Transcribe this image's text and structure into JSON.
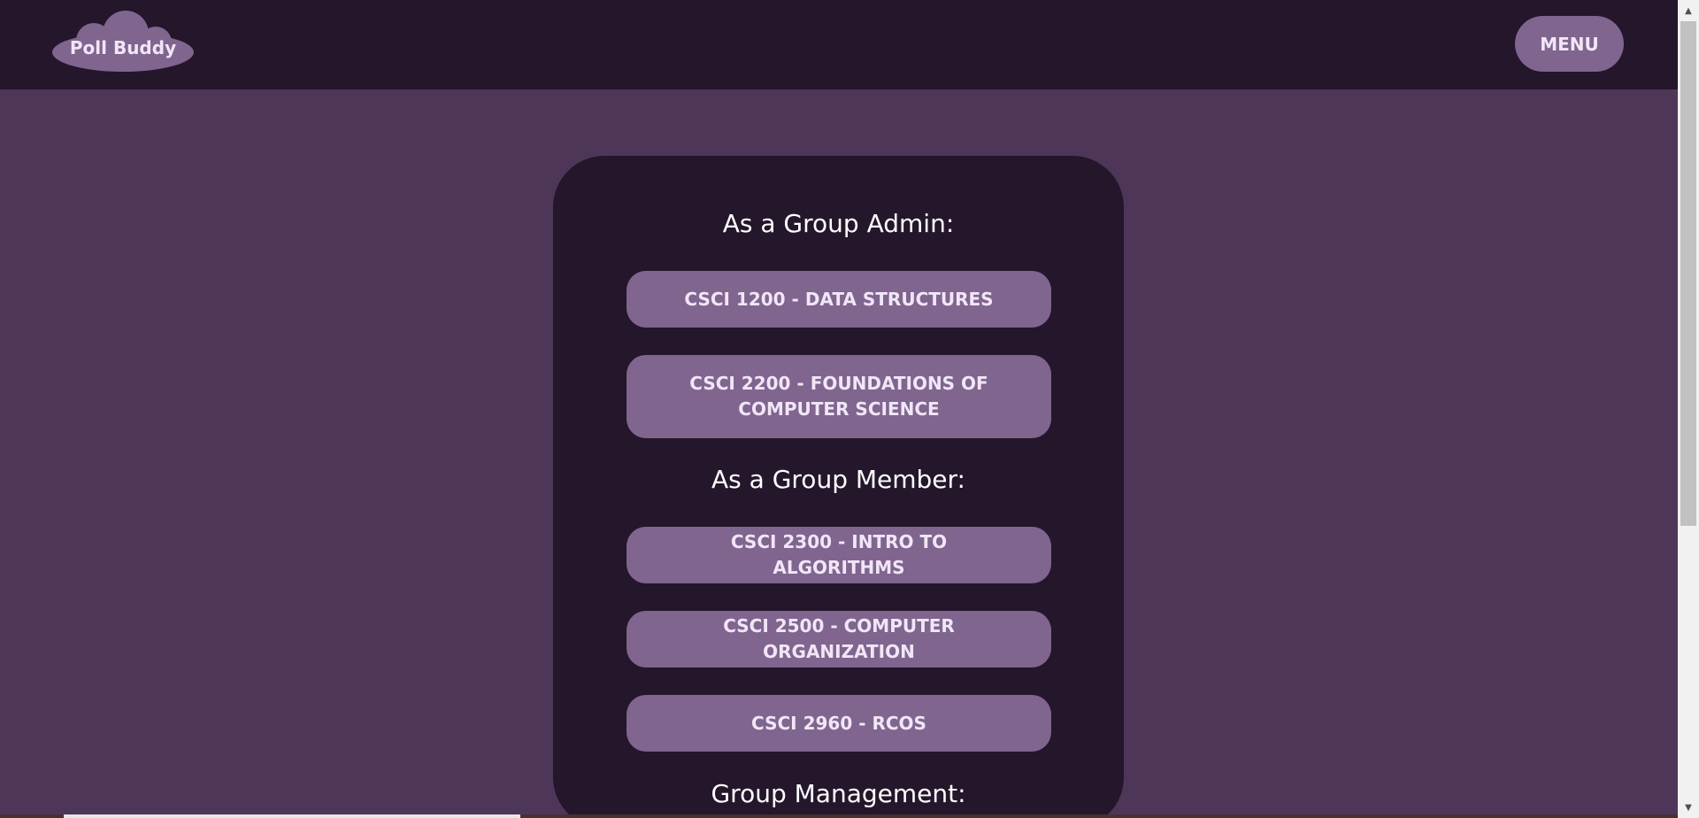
{
  "header": {
    "logo_text": "Poll Buddy",
    "menu_label": "MENU"
  },
  "sections": {
    "admin_heading": "As a Group Admin:",
    "member_heading": "As a Group Member:",
    "management_heading": "Group Management:"
  },
  "admin_groups": [
    "CSCI 1200 - DATA STRUCTURES",
    "CSCI 2200 - FOUNDATIONS OF COMPUTER SCIENCE"
  ],
  "member_groups": [
    "CSCI 2300 - INTRO TO ALGORITHMS",
    "CSCI 2500 - COMPUTER ORGANIZATION",
    "CSCI 2960 - RCOS"
  ],
  "colors": {
    "page_background": "#4e3659",
    "header_background": "#24162b",
    "card_background": "#24162b",
    "button_background": "#80658f",
    "button_text": "#f1e6f7"
  }
}
